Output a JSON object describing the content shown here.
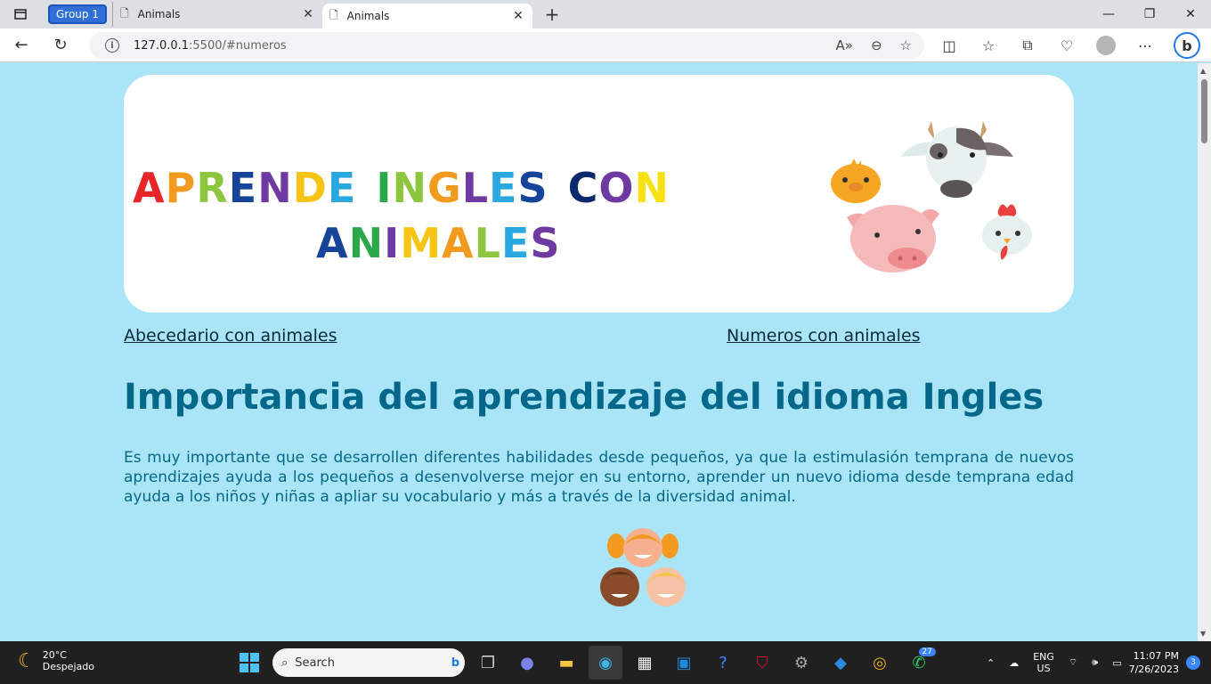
{
  "browser": {
    "group_label": "Group 1",
    "tabs": [
      {
        "title": "Animals",
        "active": false
      },
      {
        "title": "Animals",
        "active": true
      }
    ],
    "url_host": "127.0.0.1",
    "url_path": ":5500/#numeros"
  },
  "page": {
    "banner": {
      "words_line1": [
        {
          "text": "APRENDE",
          "colors": [
            "#e8262a",
            "#f29a1f",
            "#8cc63f",
            "#16449a",
            "#6e3aa1",
            "#f7c414",
            "#29a8e0"
          ]
        },
        {
          "text": "INGLES",
          "colors": [
            "#2aa84a",
            "#8cc63f",
            "#f29a1f",
            "#6e3aa1",
            "#29a8e0",
            "#16449a"
          ]
        },
        {
          "text": "CON",
          "colors": [
            "#0b2a6e",
            "#6e3aa1",
            "#f7e014"
          ]
        }
      ],
      "words_line2": [
        {
          "text": "ANIMALES",
          "colors": [
            "#16449a",
            "#2aa84a",
            "#6e3aa1",
            "#f7c414",
            "#f29a1f",
            "#8cc63f",
            "#29a8e0",
            "#6e3aa1"
          ]
        }
      ]
    },
    "nav": {
      "link1": "Abecedario con animales",
      "link2": "Numeros con animales"
    },
    "heading": "Importancia del aprendizaje del idioma Ingles",
    "paragraph": "Es muy importante que se desarrollen diferentes habilidades desde pequeños, ya que la estimulasión temprana de nuevos aprendizajes ayuda a los pequeños a desenvolverse mejor en su entorno, aprender un nuevo idioma desde temprana edad ayuda a los niños y niñas a apliar su vocabulario y más a través de la diversidad animal."
  },
  "taskbar": {
    "temperature": "20°C",
    "condition": "Despejado",
    "search_placeholder": "Search",
    "whatsapp_badge": "27",
    "lang_line1": "ENG",
    "lang_line2": "US",
    "time": "11:07 PM",
    "date": "7/26/2023",
    "notification_count": "3"
  },
  "colors": {
    "page_bg": "#a9e5f7",
    "heading": "#05688a",
    "link": "#0a2a3a"
  }
}
